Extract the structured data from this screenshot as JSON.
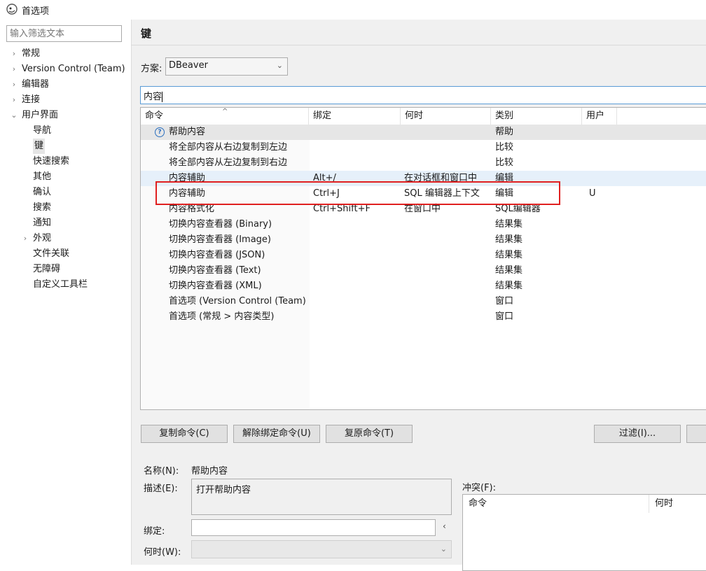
{
  "window": {
    "title": "首选项"
  },
  "sidebar": {
    "filter_placeholder": "输入筛选文本",
    "items": [
      {
        "label": "常规",
        "arrow": "›"
      },
      {
        "label": "Version Control (Team)",
        "arrow": "›"
      },
      {
        "label": "编辑器",
        "arrow": "›"
      },
      {
        "label": "连接",
        "arrow": "›"
      },
      {
        "label": "用户界面",
        "arrow": "⌄"
      },
      {
        "label": "导航"
      },
      {
        "label": "键"
      },
      {
        "label": "快速搜索"
      },
      {
        "label": "其他"
      },
      {
        "label": "确认"
      },
      {
        "label": "搜索"
      },
      {
        "label": "通知"
      },
      {
        "label": "外观",
        "arrow": "›"
      },
      {
        "label": "文件关联"
      },
      {
        "label": "无障碍"
      },
      {
        "label": "自定义工具栏"
      }
    ]
  },
  "page": {
    "title": "键",
    "scheme_label": "方案:",
    "scheme_value": "DBeaver",
    "search_value": "内容"
  },
  "table": {
    "headers": {
      "command": "命令",
      "binding": "绑定",
      "when": "何时",
      "category": "类别",
      "user": "用户"
    },
    "rows": [
      {
        "command": "帮助内容",
        "binding": "",
        "when": "",
        "category": "帮助",
        "user": ""
      },
      {
        "command": "将全部内容从右边复制到左边",
        "binding": "",
        "when": "",
        "category": "比较",
        "user": ""
      },
      {
        "command": "将全部内容从左边复制到右边",
        "binding": "",
        "when": "",
        "category": "比较",
        "user": ""
      },
      {
        "command": "内容辅助",
        "binding": "Alt+/",
        "when": "在对话框和窗口中",
        "category": "编辑",
        "user": ""
      },
      {
        "command": "内容辅助",
        "binding": "Ctrl+J",
        "when": "SQL 编辑器上下文",
        "category": "编辑",
        "user": "U"
      },
      {
        "command": "内容格式化",
        "binding": "Ctrl+Shift+F",
        "when": "在窗口中",
        "category": "SQL编辑器",
        "user": ""
      },
      {
        "command": "切换内容查看器 (Binary)",
        "binding": "",
        "when": "",
        "category": "结果集",
        "user": ""
      },
      {
        "command": "切换内容查看器 (Image)",
        "binding": "",
        "when": "",
        "category": "结果集",
        "user": ""
      },
      {
        "command": "切换内容查看器 (JSON)",
        "binding": "",
        "when": "",
        "category": "结果集",
        "user": ""
      },
      {
        "command": "切换内容查看器 (Text)",
        "binding": "",
        "when": "",
        "category": "结果集",
        "user": ""
      },
      {
        "command": "切换内容查看器 (XML)",
        "binding": "",
        "when": "",
        "category": "结果集",
        "user": ""
      },
      {
        "command": "首选项 (Version Control (Team) >",
        "binding": "",
        "when": "",
        "category": "窗口",
        "user": ""
      },
      {
        "command": "首选项 (常规 > 内容类型)",
        "binding": "",
        "when": "",
        "category": "窗口",
        "user": ""
      }
    ]
  },
  "buttons": {
    "copy": "复制命令(C)",
    "unbind": "解除绑定命令(U)",
    "restore": "复原命令(T)",
    "filter": "过滤(I)..."
  },
  "details": {
    "name_label": "名称(N):",
    "name_value": "帮助内容",
    "desc_label": "描述(E):",
    "desc_value": "打开帮助内容",
    "binding_label": "绑定:",
    "when_label": "何时(W):",
    "conflict_label": "冲突(F):",
    "conflict_headers": {
      "command": "命令",
      "when": "何时"
    }
  },
  "colors": {
    "highlight": "#e02020",
    "accent": "#5a9bd5",
    "help_icon": "#2a6fbf"
  }
}
